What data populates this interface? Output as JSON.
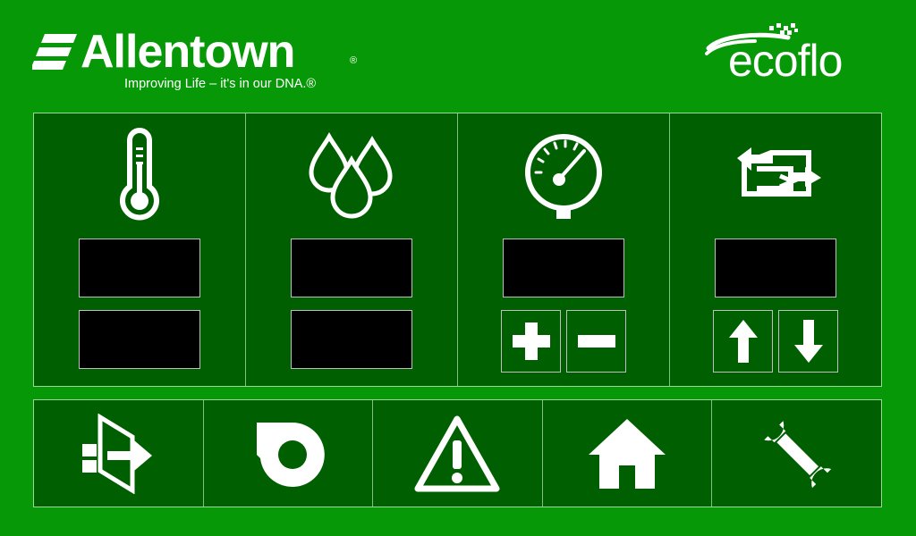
{
  "brand": {
    "name": "Allentown",
    "trademark": "®",
    "tagline": "Improving Life – it's in our DNA.®",
    "partner": "ecoflo"
  },
  "columns": [
    {
      "id": "temperature",
      "icon": "thermometer-icon"
    },
    {
      "id": "humidity",
      "icon": "water-drops-icon"
    },
    {
      "id": "pressure",
      "icon": "pressure-gauge-icon"
    },
    {
      "id": "airflow",
      "icon": "air-exchange-icon"
    }
  ],
  "controls": {
    "pressure": [
      "plus-icon",
      "minus-icon"
    ],
    "airflow": [
      "arrow-up-icon",
      "arrow-down-icon"
    ]
  },
  "nav": [
    "exit-icon",
    "blower-icon",
    "warning-icon",
    "home-icon",
    "wrench-icon"
  ],
  "colors": {
    "background": "#069806",
    "panel": "#005f00",
    "display": "#000000",
    "icon": "#ffffff"
  }
}
